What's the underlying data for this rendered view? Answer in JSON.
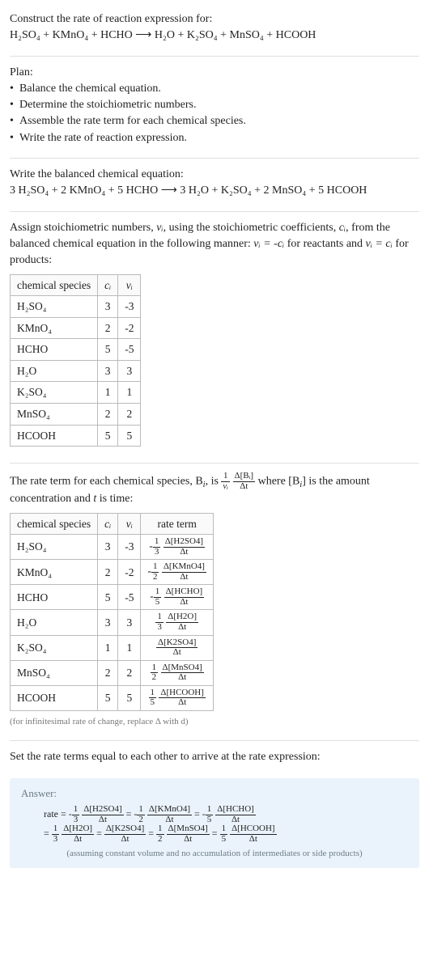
{
  "intro": {
    "line1": "Construct the rate of reaction expression for:",
    "eq_lhs": "H₂SO₄ + KMnO₄ + HCHO",
    "eq_arrow": "⟶",
    "eq_rhs": "H₂O + K₂SO₄ + MnSO₄ + HCOOH"
  },
  "plan": {
    "title": "Plan:",
    "items": [
      "Balance the chemical equation.",
      "Determine the stoichiometric numbers.",
      "Assemble the rate term for each chemical species.",
      "Write the rate of reaction expression."
    ]
  },
  "balanced": {
    "title": "Write the balanced chemical equation:",
    "eq": "3 H₂SO₄ + 2 KMnO₄ + 5 HCHO  ⟶  3 H₂O + K₂SO₄ + 2 MnSO₄ + 5 HCOOH"
  },
  "assign_text": {
    "part1": "Assign stoichiometric numbers, ",
    "nu": "νᵢ",
    "part2": ", using the stoichiometric coefficients, ",
    "ci": "cᵢ",
    "part3": ", from the balanced chemical equation in the following manner: ",
    "rel_react": "νᵢ = -cᵢ",
    "part4": " for reactants and ",
    "rel_prod": "νᵢ = cᵢ",
    "part5": " for products:"
  },
  "table1": {
    "headers": [
      "chemical species",
      "cᵢ",
      "νᵢ"
    ],
    "rows": [
      [
        "H₂SO₄",
        "3",
        "-3"
      ],
      [
        "KMnO₄",
        "2",
        "-2"
      ],
      [
        "HCHO",
        "5",
        "-5"
      ],
      [
        "H₂O",
        "3",
        "3"
      ],
      [
        "K₂SO₄",
        "1",
        "1"
      ],
      [
        "MnSO₄",
        "2",
        "2"
      ],
      [
        "HCOOH",
        "5",
        "5"
      ]
    ]
  },
  "rate_term_text": {
    "part1": "The rate term for each chemical species, B",
    "sub_i": "i",
    "part2": ", is ",
    "frac1_num": "1",
    "frac1_den": "νᵢ",
    "frac2_num": "Δ[Bᵢ]",
    "frac2_den": "Δt",
    "part3": " where [B",
    "part4": "] is the amount concentration and ",
    "t": "t",
    "part5": " is time:"
  },
  "table2": {
    "headers": [
      "chemical species",
      "cᵢ",
      "νᵢ",
      "rate term"
    ],
    "rows": [
      {
        "sp": "H₂SO₄",
        "c": "3",
        "nu": "-3",
        "neg": "-",
        "coef_num": "1",
        "coef_den": "3",
        "dnum": "Δ[H2SO4]",
        "dden": "Δt"
      },
      {
        "sp": "KMnO₄",
        "c": "2",
        "nu": "-2",
        "neg": "-",
        "coef_num": "1",
        "coef_den": "2",
        "dnum": "Δ[KMnO4]",
        "dden": "Δt"
      },
      {
        "sp": "HCHO",
        "c": "5",
        "nu": "-5",
        "neg": "-",
        "coef_num": "1",
        "coef_den": "5",
        "dnum": "Δ[HCHO]",
        "dden": "Δt"
      },
      {
        "sp": "H₂O",
        "c": "3",
        "nu": "3",
        "neg": "",
        "coef_num": "1",
        "coef_den": "3",
        "dnum": "Δ[H2O]",
        "dden": "Δt"
      },
      {
        "sp": "K₂SO₄",
        "c": "1",
        "nu": "1",
        "neg": "",
        "coef_num": "",
        "coef_den": "",
        "dnum": "Δ[K2SO4]",
        "dden": "Δt"
      },
      {
        "sp": "MnSO₄",
        "c": "2",
        "nu": "2",
        "neg": "",
        "coef_num": "1",
        "coef_den": "2",
        "dnum": "Δ[MnSO4]",
        "dden": "Δt"
      },
      {
        "sp": "HCOOH",
        "c": "5",
        "nu": "5",
        "neg": "",
        "coef_num": "1",
        "coef_den": "5",
        "dnum": "Δ[HCOOH]",
        "dden": "Δt"
      }
    ],
    "note": "(for infinitesimal rate of change, replace Δ with d)"
  },
  "set_equal": "Set the rate terms equal to each other to arrive at the rate expression:",
  "answer": {
    "label": "Answer:",
    "rate_eq_prefix": "rate = ",
    "terms": [
      {
        "neg": "-",
        "cn": "1",
        "cd": "3",
        "dn": "Δ[H2SO4]",
        "dd": "Δt"
      },
      {
        "neg": "-",
        "cn": "1",
        "cd": "2",
        "dn": "Δ[KMnO4]",
        "dd": "Δt"
      },
      {
        "neg": "-",
        "cn": "1",
        "cd": "5",
        "dn": "Δ[HCHO]",
        "dd": "Δt"
      },
      {
        "neg": "",
        "cn": "1",
        "cd": "3",
        "dn": "Δ[H2O]",
        "dd": "Δt"
      },
      {
        "neg": "",
        "cn": "",
        "cd": "",
        "dn": "Δ[K2SO4]",
        "dd": "Δt"
      },
      {
        "neg": "",
        "cn": "1",
        "cd": "2",
        "dn": "Δ[MnSO4]",
        "dd": "Δt"
      },
      {
        "neg": "",
        "cn": "1",
        "cd": "5",
        "dn": "Δ[HCOOH]",
        "dd": "Δt"
      }
    ],
    "note": "(assuming constant volume and no accumulation of intermediates or side products)"
  },
  "chart_data": {
    "type": "table",
    "tables": [
      {
        "title": "Stoichiometric numbers",
        "headers": [
          "chemical species",
          "c_i",
          "nu_i"
        ],
        "rows": [
          [
            "H2SO4",
            3,
            -3
          ],
          [
            "KMnO4",
            2,
            -2
          ],
          [
            "HCHO",
            5,
            -5
          ],
          [
            "H2O",
            3,
            3
          ],
          [
            "K2SO4",
            1,
            1
          ],
          [
            "MnSO4",
            2,
            2
          ],
          [
            "HCOOH",
            5,
            5
          ]
        ]
      },
      {
        "title": "Rate terms",
        "headers": [
          "chemical species",
          "c_i",
          "nu_i",
          "rate term"
        ],
        "rows": [
          [
            "H2SO4",
            3,
            -3,
            "-(1/3) d[H2SO4]/dt"
          ],
          [
            "KMnO4",
            2,
            -2,
            "-(1/2) d[KMnO4]/dt"
          ],
          [
            "HCHO",
            5,
            -5,
            "-(1/5) d[HCHO]/dt"
          ],
          [
            "H2O",
            3,
            3,
            "(1/3) d[H2O]/dt"
          ],
          [
            "K2SO4",
            1,
            1,
            "d[K2SO4]/dt"
          ],
          [
            "MnSO4",
            2,
            2,
            "(1/2) d[MnSO4]/dt"
          ],
          [
            "HCOOH",
            5,
            5,
            "(1/5) d[HCOOH]/dt"
          ]
        ]
      }
    ]
  }
}
